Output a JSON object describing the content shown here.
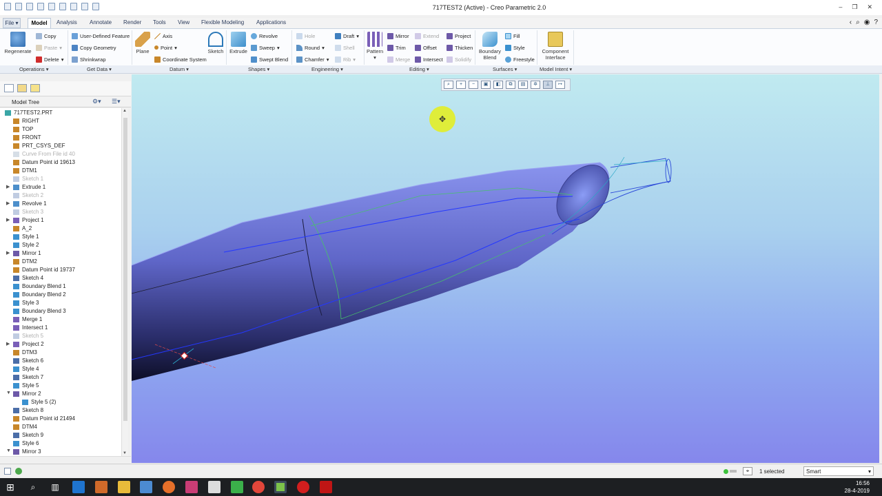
{
  "window": {
    "title": "717TEST2 (Active) - Creo Parametric 2.0"
  },
  "menu": {
    "tabs": [
      "File",
      "Model",
      "Analysis",
      "Annotate",
      "Render",
      "Tools",
      "View",
      "Flexible Modeling",
      "Applications"
    ],
    "active": "Model"
  },
  "ribbon": {
    "regenerate": "Regenerate",
    "copy": "Copy",
    "paste": "Paste",
    "delete": "Delete",
    "user_defined_feature": "User-Defined Feature",
    "copy_geometry": "Copy Geometry",
    "shrinkwrap": "Shrinkwrap",
    "plane": "Plane",
    "axis": "Axis",
    "point": "Point",
    "coordinate_system": "Coordinate System",
    "sketch": "Sketch",
    "extrude": "Extrude",
    "revolve": "Revolve",
    "sweep": "Sweep",
    "swept_blend": "Swept Blend",
    "hole": "Hole",
    "round": "Round",
    "chamfer": "Chamfer",
    "draft": "Draft",
    "shell": "Shell",
    "rib": "Rib",
    "pattern": "Pattern",
    "mirror": "Mirror",
    "trim": "Trim",
    "merge": "Merge",
    "extend": "Extend",
    "offset": "Offset",
    "intersect": "Intersect",
    "project": "Project",
    "thicken": "Thicken",
    "solidify": "Solidify",
    "boundary_blend": "Boundary Blend",
    "fill": "Fill",
    "style": "Style",
    "freestyle": "Freestyle",
    "component_interface": "Component Interface",
    "groups": {
      "operations": "Operations ▾",
      "get_data": "Get Data ▾",
      "datum": "Datum ▾",
      "shapes": "Shapes ▾",
      "engineering": "Engineering ▾",
      "editing": "Editing ▾",
      "surfaces": "Surfaces ▾",
      "model_intent": "Model Intent ▾"
    }
  },
  "model_tree": {
    "header": "Model Tree",
    "items": [
      {
        "label": "717TEST2.PRT",
        "icon": "part-icon",
        "state": "normal",
        "exp": ""
      },
      {
        "label": "RIGHT",
        "icon": "datum-plane-icon",
        "state": "normal",
        "exp": ""
      },
      {
        "label": "TOP",
        "icon": "datum-plane-icon",
        "state": "normal",
        "exp": ""
      },
      {
        "label": "FRONT",
        "icon": "datum-plane-icon",
        "state": "normal",
        "exp": ""
      },
      {
        "label": "PRT_CSYS_DEF",
        "icon": "csys-icon",
        "state": "normal",
        "exp": ""
      },
      {
        "label": "Curve From File id 40",
        "icon": "curve-icon",
        "state": "suppressed",
        "exp": ""
      },
      {
        "label": "Datum Point id 19613",
        "icon": "datum-point-icon",
        "state": "normal",
        "exp": ""
      },
      {
        "label": "DTM1",
        "icon": "datum-plane-icon",
        "state": "normal",
        "exp": ""
      },
      {
        "label": "Sketch 1",
        "icon": "sketch-icon",
        "state": "suppressed",
        "exp": ""
      },
      {
        "label": "Extrude 1",
        "icon": "extrude-icon",
        "state": "normal",
        "exp": "▶"
      },
      {
        "label": "Sketch 2",
        "icon": "sketch-icon",
        "state": "suppressed",
        "exp": ""
      },
      {
        "label": "Revolve 1",
        "icon": "revolve-icon",
        "state": "normal",
        "exp": "▶"
      },
      {
        "label": "Sketch 3",
        "icon": "sketch-icon",
        "state": "suppressed",
        "exp": ""
      },
      {
        "label": "Project 1",
        "icon": "project-icon",
        "state": "normal",
        "exp": "▶"
      },
      {
        "label": "A_2",
        "icon": "axis-icon",
        "state": "normal",
        "exp": ""
      },
      {
        "label": "Style 1",
        "icon": "style-icon",
        "state": "normal",
        "exp": ""
      },
      {
        "label": "Style 2",
        "icon": "style-icon",
        "state": "normal",
        "exp": ""
      },
      {
        "label": "Mirror 1",
        "icon": "mirror-icon",
        "state": "normal",
        "exp": "▶"
      },
      {
        "label": "DTM2",
        "icon": "datum-plane-icon",
        "state": "normal",
        "exp": ""
      },
      {
        "label": "Datum Point id 19737",
        "icon": "datum-point-icon",
        "state": "normal",
        "exp": ""
      },
      {
        "label": "Sketch 4",
        "icon": "sketch-icon",
        "state": "normal",
        "exp": ""
      },
      {
        "label": "Boundary Blend 1",
        "icon": "boundary-blend-icon",
        "state": "normal",
        "exp": ""
      },
      {
        "label": "Boundary Blend 2",
        "icon": "boundary-blend-icon",
        "state": "normal",
        "exp": ""
      },
      {
        "label": "Style 3",
        "icon": "style-icon",
        "state": "normal",
        "exp": ""
      },
      {
        "label": "Boundary Blend 3",
        "icon": "boundary-blend-icon",
        "state": "normal",
        "exp": ""
      },
      {
        "label": "Merge 1",
        "icon": "merge-icon",
        "state": "normal",
        "exp": ""
      },
      {
        "label": "Intersect 1",
        "icon": "intersect-icon",
        "state": "normal",
        "exp": ""
      },
      {
        "label": "Sketch 5",
        "icon": "sketch-icon",
        "state": "suppressed",
        "exp": ""
      },
      {
        "label": "Project 2",
        "icon": "project-icon",
        "state": "normal",
        "exp": "▶"
      },
      {
        "label": "DTM3",
        "icon": "datum-plane-icon",
        "state": "normal",
        "exp": ""
      },
      {
        "label": "Sketch 6",
        "icon": "sketch-icon",
        "state": "normal",
        "exp": ""
      },
      {
        "label": "Style 4",
        "icon": "style-icon",
        "state": "normal",
        "exp": ""
      },
      {
        "label": "Sketch 7",
        "icon": "sketch-icon",
        "state": "normal",
        "exp": ""
      },
      {
        "label": "Style 5",
        "icon": "style-icon",
        "state": "normal",
        "exp": ""
      },
      {
        "label": "Mirror 2",
        "icon": "mirror-icon",
        "state": "normal",
        "exp": "▼"
      },
      {
        "label": "Style 5 (2)",
        "icon": "style-icon",
        "state": "child",
        "exp": ""
      },
      {
        "label": "Sketch 8",
        "icon": "sketch-icon",
        "state": "normal",
        "exp": ""
      },
      {
        "label": "Datum Point id 21494",
        "icon": "datum-point-icon",
        "state": "normal",
        "exp": ""
      },
      {
        "label": "DTM4",
        "icon": "datum-plane-icon",
        "state": "normal",
        "exp": ""
      },
      {
        "label": "Sketch 9",
        "icon": "sketch-icon",
        "state": "normal",
        "exp": ""
      },
      {
        "label": "Style 6",
        "icon": "style-icon",
        "state": "normal",
        "exp": ""
      },
      {
        "label": "Mirror 3",
        "icon": "mirror-icon",
        "state": "normal",
        "exp": "▼"
      }
    ]
  },
  "status": {
    "selected": "1 selected",
    "filter": "Smart"
  },
  "taskbar": {
    "time": "16:56",
    "date": "28-4-2019"
  },
  "colors": {
    "accent": "#2a6ebb",
    "viewport_top": "#c0eaf0",
    "viewport_bottom": "#8587ec",
    "surface": "#6870d0"
  }
}
